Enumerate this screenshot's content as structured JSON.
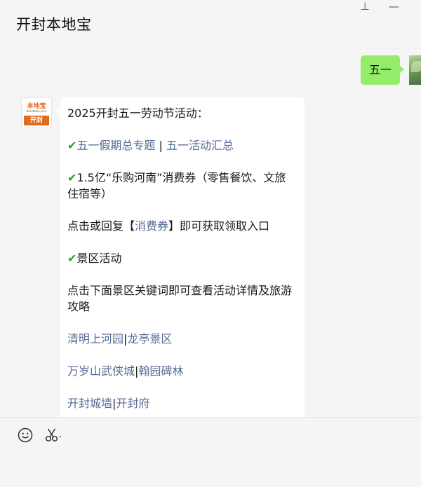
{
  "window": {
    "title": "开封本地宝",
    "pin_glyph": "⊥",
    "minimize_glyph": "—"
  },
  "conversation": {
    "outgoing_message": "五一",
    "bot_avatar": {
      "logo_top": "本地宝",
      "logo_domain": "Bendibao.com",
      "logo_city": "开封"
    },
    "incoming": {
      "heading": "2025开封五一劳动节活动：",
      "line1": {
        "check": "✔",
        "link_a": "五一假期总专题",
        "sep": " | ",
        "link_b": "五一活动汇总"
      },
      "line2": {
        "check": "✔",
        "text": "1.5亿“乐购河南”消费券（零售餐饮、文旅住宿等）"
      },
      "line3": {
        "before": "点击或回复【",
        "link": "消费券",
        "after": "】即可获取领取入口"
      },
      "line4": {
        "check": "✔",
        "text": "景区活动"
      },
      "line5": {
        "text": "点击下面景区关键词即可查看活动详情及旅游攻略"
      },
      "line6": {
        "link_a": "清明上河园",
        "sep": "|",
        "link_b": "龙亭景区"
      },
      "line7": {
        "link_a": "万岁山武侠城",
        "sep": "|",
        "link_b": "翰园碑林"
      },
      "line8": {
        "link_a": "开封城墙",
        "sep": "|",
        "link_b": "开封府"
      }
    }
  },
  "toolbar": {
    "icons": [
      "emoji-icon",
      "scissors-icon"
    ]
  },
  "colors": {
    "my_bubble": "#95ec69",
    "link": "#576b95",
    "check": "#1aa33a",
    "logo": "#e36a1c"
  }
}
